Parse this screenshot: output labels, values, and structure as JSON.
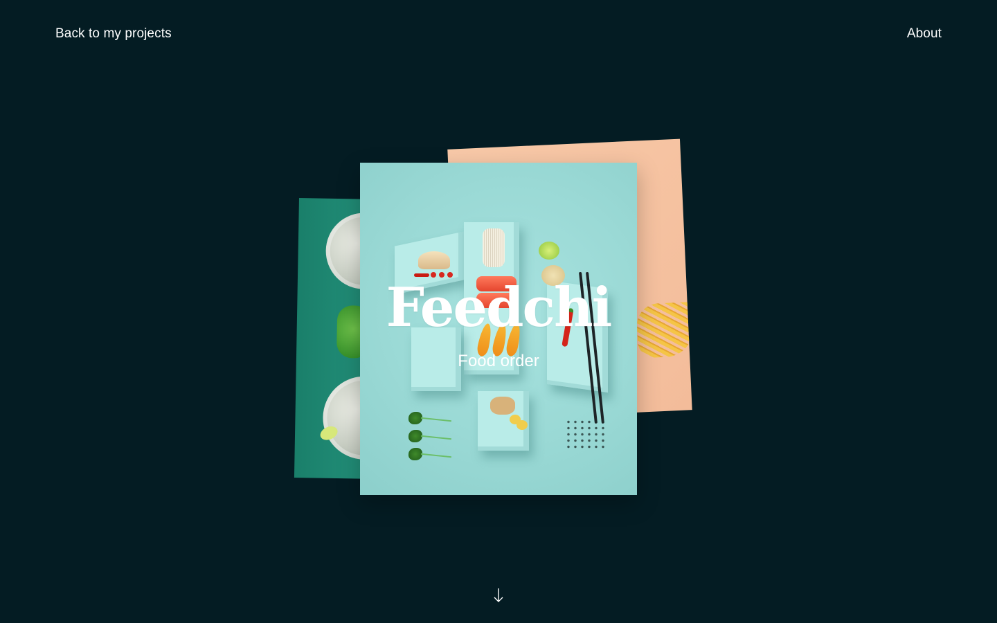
{
  "nav": {
    "back_label": "Back to my projects",
    "about_label": "About"
  },
  "project": {
    "title": "Feedchi",
    "subtitle": "Food order"
  },
  "colors": {
    "background": "#041c23",
    "card_main": "#9ad9d5",
    "card_peach": "#f6c3a2",
    "card_green": "#23907a",
    "text": "#ffffff"
  },
  "icons": {
    "scroll": "arrow-down-icon"
  }
}
